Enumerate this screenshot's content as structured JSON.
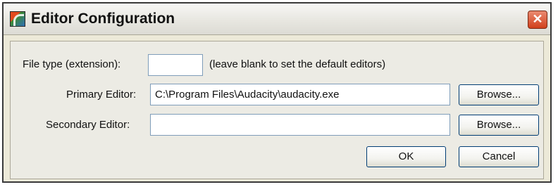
{
  "window": {
    "title": "Editor Configuration",
    "close_glyph": "✕"
  },
  "form": {
    "file_type_label": "File type (extension):",
    "file_type_value": "",
    "file_type_hint": "(leave blank to set the default editors)",
    "primary_label": "Primary Editor:",
    "primary_value": "C:\\Program Files\\Audacity\\audacity.exe",
    "secondary_label": "Secondary Editor:",
    "secondary_value": ""
  },
  "buttons": {
    "browse_primary": "Browse...",
    "browse_secondary": "Browse...",
    "ok": "OK",
    "cancel": "Cancel"
  }
}
